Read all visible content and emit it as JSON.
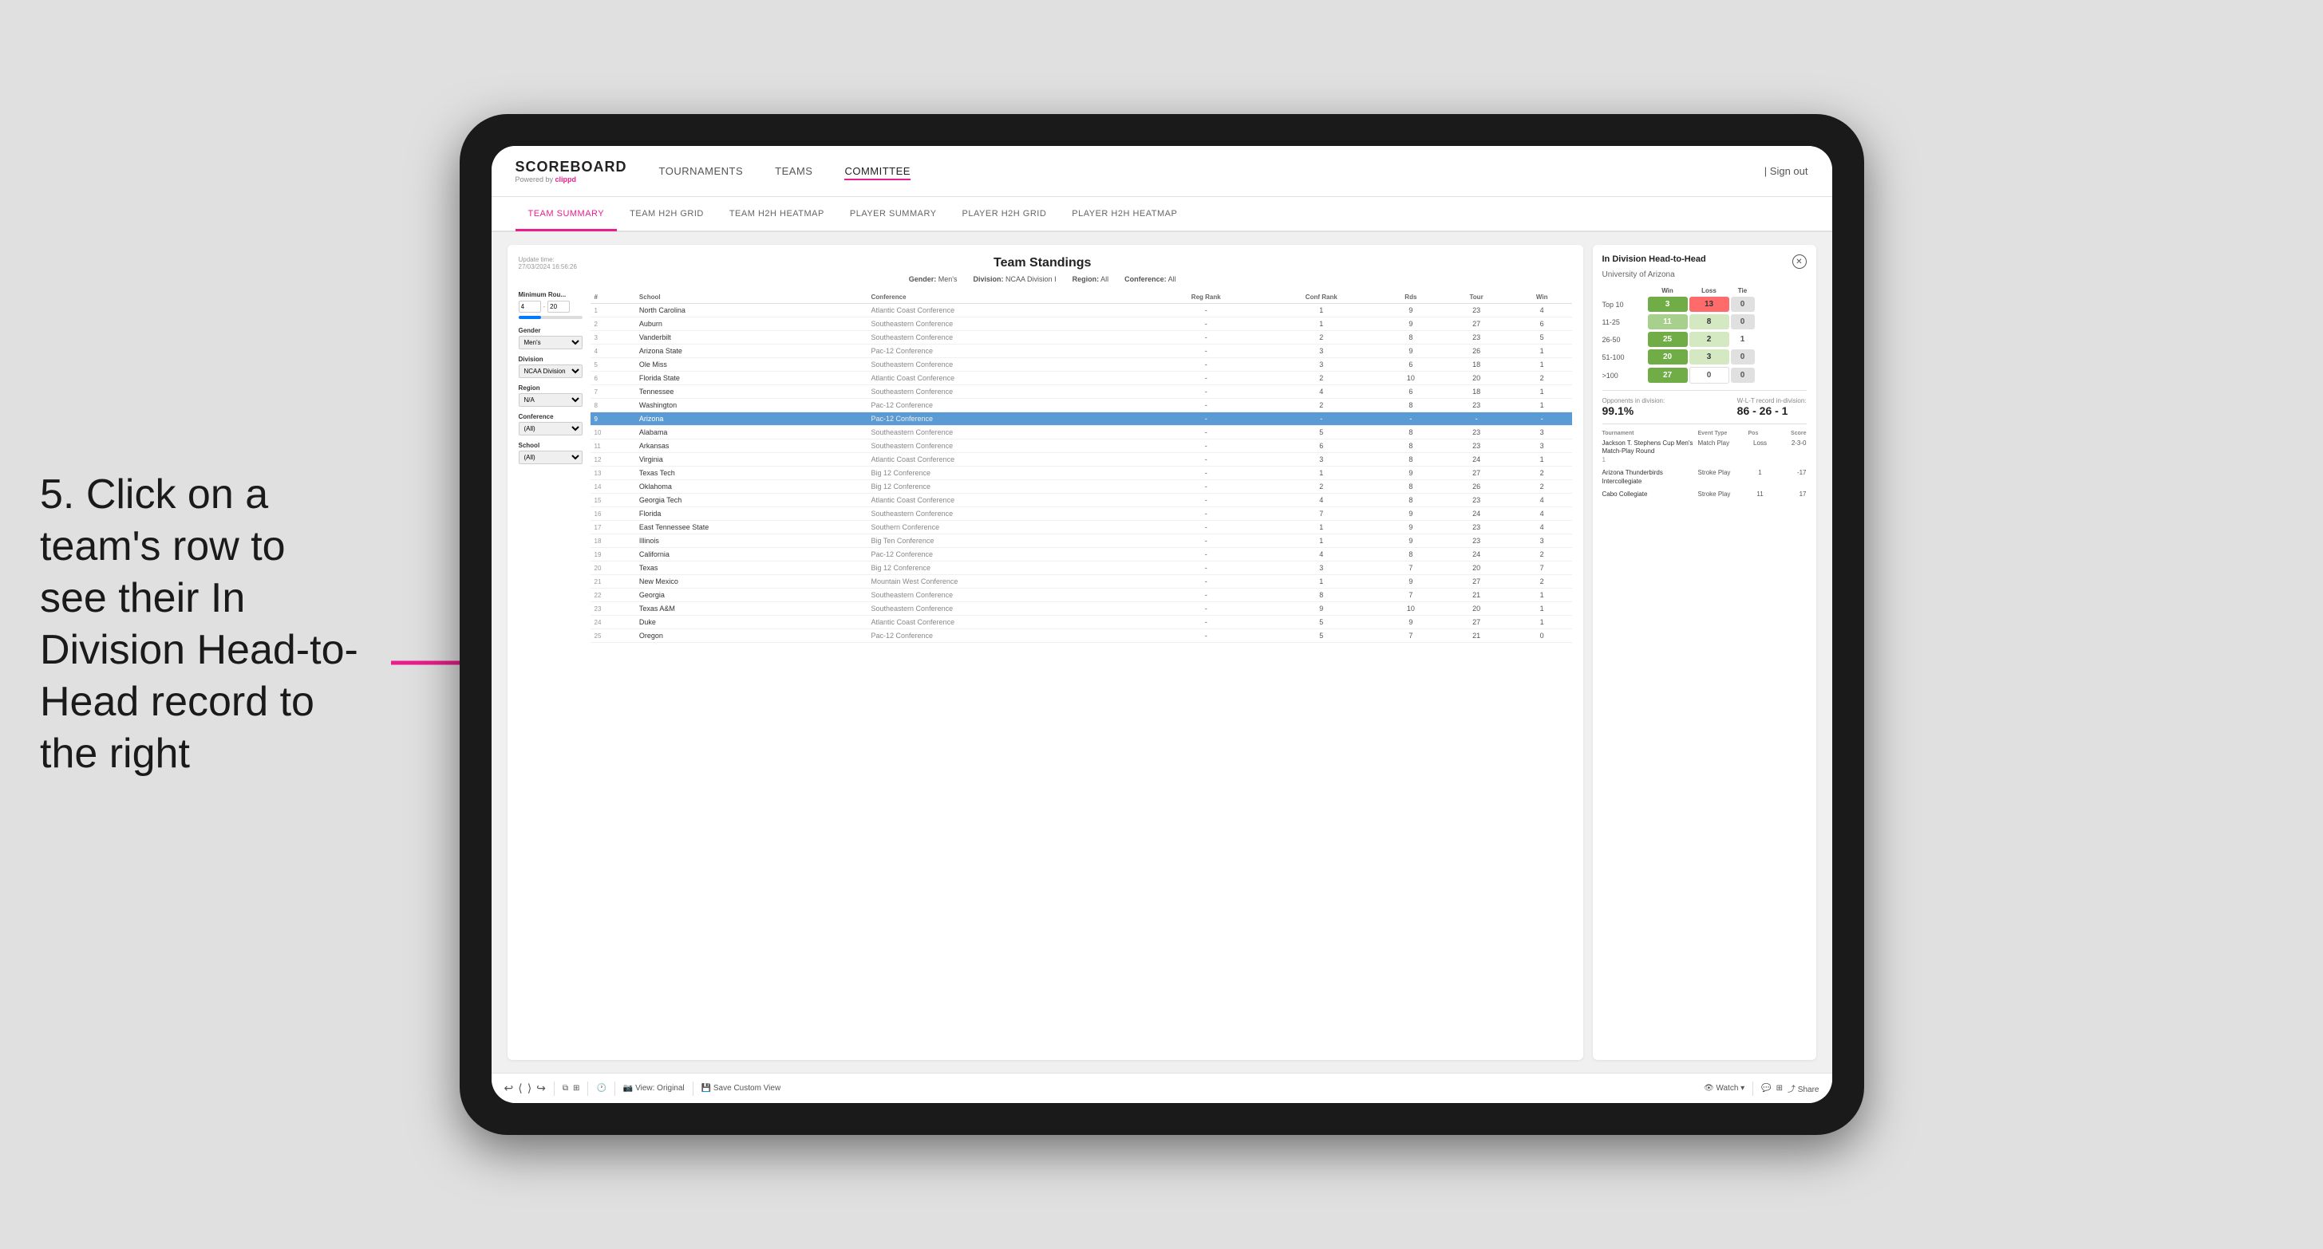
{
  "annotation": {
    "step": "5. Click on a team's row to see their In Division Head-to-Head record to the right"
  },
  "nav": {
    "logo": "SCOREBOARD",
    "powered_by": "Powered by clippd",
    "items": [
      "TOURNAMENTS",
      "TEAMS",
      "COMMITTEE"
    ],
    "active_item": "COMMITTEE",
    "sign_out": "Sign out"
  },
  "sub_nav": {
    "items": [
      "TEAM SUMMARY",
      "TEAM H2H GRID",
      "TEAM H2H HEATMAP",
      "PLAYER SUMMARY",
      "PLAYER H2H GRID",
      "PLAYER H2H HEATMAP"
    ],
    "active_item": "PLAYER SUMMARY"
  },
  "page": {
    "update_time": "Update time:",
    "update_date": "27/03/2024 16:56:26",
    "title": "Team Standings",
    "gender_label": "Gender:",
    "gender_value": "Men's",
    "division_label": "Division:",
    "division_value": "NCAA Division I",
    "region_label": "Region:",
    "region_value": "All",
    "conference_label": "Conference:",
    "conference_value": "All"
  },
  "filters": {
    "min_rounds_label": "Minimum Rou...",
    "min_rounds_value": "4",
    "min_rounds_max": "20",
    "gender_label": "Gender",
    "gender_value": "Men's",
    "division_label": "Division",
    "division_value": "NCAA Division I",
    "region_label": "Region",
    "region_value": "N/A",
    "conference_label": "Conference",
    "conference_value": "(All)",
    "school_label": "School",
    "school_value": "(All)"
  },
  "table": {
    "headers": [
      "#",
      "School",
      "Conference",
      "Reg Rank",
      "Conf Rank",
      "Rds",
      "Tour",
      "Win"
    ],
    "rows": [
      {
        "rank": 1,
        "school": "North Carolina",
        "conference": "Atlantic Coast Conference",
        "reg_rank": "-",
        "conf_rank": 1,
        "rds": 9,
        "tour": 23,
        "win": 4,
        "highlighted": false
      },
      {
        "rank": 2,
        "school": "Auburn",
        "conference": "Southeastern Conference",
        "reg_rank": "-",
        "conf_rank": 1,
        "rds": 9,
        "tour": 27,
        "win": 6,
        "highlighted": false
      },
      {
        "rank": 3,
        "school": "Vanderbilt",
        "conference": "Southeastern Conference",
        "reg_rank": "-",
        "conf_rank": 2,
        "rds": 8,
        "tour": 23,
        "win": 5,
        "highlighted": false
      },
      {
        "rank": 4,
        "school": "Arizona State",
        "conference": "Pac-12 Conference",
        "reg_rank": "-",
        "conf_rank": 3,
        "rds": 9,
        "tour": 26,
        "win": 1,
        "highlighted": false
      },
      {
        "rank": 5,
        "school": "Ole Miss",
        "conference": "Southeastern Conference",
        "reg_rank": "-",
        "conf_rank": 3,
        "rds": 6,
        "tour": 18,
        "win": 1,
        "highlighted": false
      },
      {
        "rank": 6,
        "school": "Florida State",
        "conference": "Atlantic Coast Conference",
        "reg_rank": "-",
        "conf_rank": 2,
        "rds": 10,
        "tour": 20,
        "win": 2,
        "highlighted": false
      },
      {
        "rank": 7,
        "school": "Tennessee",
        "conference": "Southeastern Conference",
        "reg_rank": "-",
        "conf_rank": 4,
        "rds": 6,
        "tour": 18,
        "win": 1,
        "highlighted": false
      },
      {
        "rank": 8,
        "school": "Washington",
        "conference": "Pac-12 Conference",
        "reg_rank": "-",
        "conf_rank": 2,
        "rds": 8,
        "tour": 23,
        "win": 1,
        "highlighted": false
      },
      {
        "rank": 9,
        "school": "Arizona",
        "conference": "Pac-12 Conference",
        "reg_rank": "-",
        "conf_rank": "-",
        "rds": "-",
        "tour": "-",
        "win": "-",
        "highlighted": true
      },
      {
        "rank": 10,
        "school": "Alabama",
        "conference": "Southeastern Conference",
        "reg_rank": "-",
        "conf_rank": 5,
        "rds": 8,
        "tour": 23,
        "win": 3,
        "highlighted": false
      },
      {
        "rank": 11,
        "school": "Arkansas",
        "conference": "Southeastern Conference",
        "reg_rank": "-",
        "conf_rank": 6,
        "rds": 8,
        "tour": 23,
        "win": 3,
        "highlighted": false
      },
      {
        "rank": 12,
        "school": "Virginia",
        "conference": "Atlantic Coast Conference",
        "reg_rank": "-",
        "conf_rank": 3,
        "rds": 8,
        "tour": 24,
        "win": 1,
        "highlighted": false
      },
      {
        "rank": 13,
        "school": "Texas Tech",
        "conference": "Big 12 Conference",
        "reg_rank": "-",
        "conf_rank": 1,
        "rds": 9,
        "tour": 27,
        "win": 2,
        "highlighted": false
      },
      {
        "rank": 14,
        "school": "Oklahoma",
        "conference": "Big 12 Conference",
        "reg_rank": "-",
        "conf_rank": 2,
        "rds": 8,
        "tour": 26,
        "win": 2,
        "highlighted": false
      },
      {
        "rank": 15,
        "school": "Georgia Tech",
        "conference": "Atlantic Coast Conference",
        "reg_rank": "-",
        "conf_rank": 4,
        "rds": 8,
        "tour": 23,
        "win": 4,
        "highlighted": false
      },
      {
        "rank": 16,
        "school": "Florida",
        "conference": "Southeastern Conference",
        "reg_rank": "-",
        "conf_rank": 7,
        "rds": 9,
        "tour": 24,
        "win": 4,
        "highlighted": false
      },
      {
        "rank": 17,
        "school": "East Tennessee State",
        "conference": "Southern Conference",
        "reg_rank": "-",
        "conf_rank": 1,
        "rds": 9,
        "tour": 23,
        "win": 4,
        "highlighted": false
      },
      {
        "rank": 18,
        "school": "Illinois",
        "conference": "Big Ten Conference",
        "reg_rank": "-",
        "conf_rank": 1,
        "rds": 9,
        "tour": 23,
        "win": 3,
        "highlighted": false
      },
      {
        "rank": 19,
        "school": "California",
        "conference": "Pac-12 Conference",
        "reg_rank": "-",
        "conf_rank": 4,
        "rds": 8,
        "tour": 24,
        "win": 2,
        "highlighted": false
      },
      {
        "rank": 20,
        "school": "Texas",
        "conference": "Big 12 Conference",
        "reg_rank": "-",
        "conf_rank": 3,
        "rds": 7,
        "tour": 20,
        "win": 7,
        "highlighted": false
      },
      {
        "rank": 21,
        "school": "New Mexico",
        "conference": "Mountain West Conference",
        "reg_rank": "-",
        "conf_rank": 1,
        "rds": 9,
        "tour": 27,
        "win": 2,
        "highlighted": false
      },
      {
        "rank": 22,
        "school": "Georgia",
        "conference": "Southeastern Conference",
        "reg_rank": "-",
        "conf_rank": 8,
        "rds": 7,
        "tour": 21,
        "win": 1,
        "highlighted": false
      },
      {
        "rank": 23,
        "school": "Texas A&M",
        "conference": "Southeastern Conference",
        "reg_rank": "-",
        "conf_rank": 9,
        "rds": 10,
        "tour": 20,
        "win": 1,
        "highlighted": false
      },
      {
        "rank": 24,
        "school": "Duke",
        "conference": "Atlantic Coast Conference",
        "reg_rank": "-",
        "conf_rank": 5,
        "rds": 9,
        "tour": 27,
        "win": 1,
        "highlighted": false
      },
      {
        "rank": 25,
        "school": "Oregon",
        "conference": "Pac-12 Conference",
        "reg_rank": "-",
        "conf_rank": 5,
        "rds": 7,
        "tour": 21,
        "win": 0,
        "highlighted": false
      }
    ]
  },
  "h2h_panel": {
    "title": "In Division Head-to-Head",
    "team": "University of Arizona",
    "col_headers": [
      "",
      "Win",
      "Loss",
      "Tie"
    ],
    "rows": [
      {
        "label": "Top 10",
        "win": 3,
        "loss": 13,
        "tie": 0,
        "win_color": "green",
        "loss_color": "red"
      },
      {
        "label": "11-25",
        "win": 11,
        "loss": 8,
        "tie": 0,
        "win_color": "green",
        "loss_color": "light"
      },
      {
        "label": "26-50",
        "win": 25,
        "loss": 2,
        "tie": 1,
        "win_color": "dark-green",
        "loss_color": "light"
      },
      {
        "label": "51-100",
        "win": 20,
        "loss": 3,
        "tie": 0,
        "win_color": "dark-green",
        "loss_color": "light"
      },
      {
        "label": ">100",
        "win": 27,
        "loss": 0,
        "tie": 0,
        "win_color": "dark-green",
        "loss_color": "white"
      }
    ],
    "opponents_label": "Opponents in division:",
    "opponents_value": "99.1%",
    "record_label": "W-L-T record in-division:",
    "record_value": "86 - 26 - 1",
    "tournaments": {
      "headers": [
        "Tournament",
        "Event Type",
        "Pos",
        "Score"
      ],
      "rows": [
        {
          "name": "Jackson T. Stephens Cup Men's Match-Play Round",
          "event_type": "Match Play",
          "pos": "Loss",
          "score": "2-3-0",
          "sub": "1"
        },
        {
          "name": "Arizona Thunderbirds Intercollegiate",
          "event_type": "Stroke Play",
          "pos": "1",
          "score": "-17",
          "sub": ""
        },
        {
          "name": "Cabo Collegiate",
          "event_type": "Stroke Play",
          "pos": "11",
          "score": "17",
          "sub": ""
        }
      ]
    }
  },
  "toolbar": {
    "undo": "↩",
    "redo": "↪",
    "view_original": "View: Original",
    "save_custom": "Save Custom View",
    "watch": "Watch",
    "share": "Share"
  }
}
